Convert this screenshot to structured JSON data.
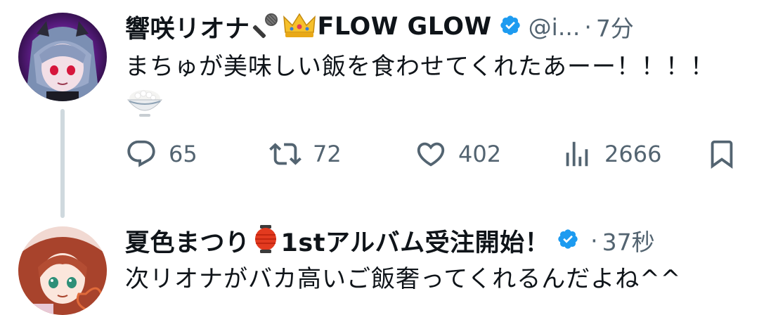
{
  "colors": {
    "text": "#0f1419",
    "muted": "#536471",
    "verified": "#1d9bf0",
    "thread_line": "#cfd9de"
  },
  "tweet1": {
    "author_name": "響咲リオナ",
    "name_suffix": "FLOW GLOW",
    "emoji_after_name": [
      "microphone-icon",
      "crown-icon"
    ],
    "handle": "@i...",
    "separator": "·",
    "time": "7分",
    "text": "まちゅが美味しい飯を食わせてくれたあーー！！！！",
    "text_emoji": "rice-bowl-icon",
    "actions": {
      "reply_count": "65",
      "retweet_count": "72",
      "like_count": "402",
      "view_count": "2666"
    }
  },
  "tweet2": {
    "author_name": "夏色まつり",
    "emoji_after_name": "lantern-icon",
    "name_suffix": "1stアルバム受注開始！",
    "separator": "·",
    "time": "37秒",
    "text": "次リオナがバカ高いご飯奢ってくれるんだよね^^"
  }
}
